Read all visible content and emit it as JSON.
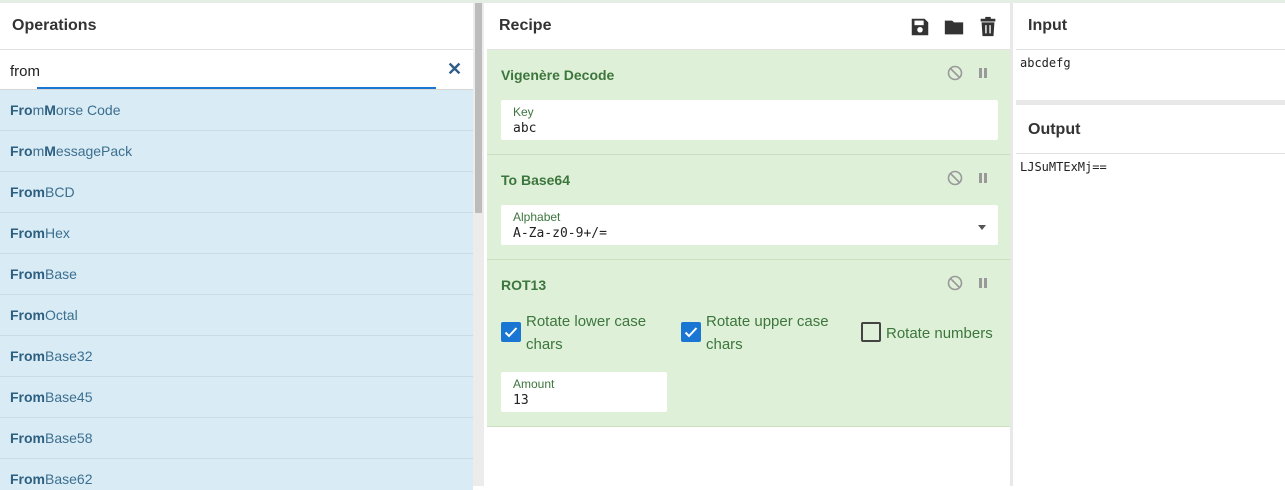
{
  "operations": {
    "title": "Operations",
    "search": {
      "value": "from",
      "clear_icon": "close-icon"
    },
    "items": [
      {
        "bold": "Fro",
        "mid": "m ",
        "bold2": "M",
        "rest": "orse Code"
      },
      {
        "bold": "Fro",
        "mid": "m ",
        "bold2": "M",
        "rest": "essagePack"
      },
      {
        "bold": "From",
        "mid": " BCD",
        "bold2": "",
        "rest": ""
      },
      {
        "bold": "From",
        "mid": " Hex",
        "bold2": "",
        "rest": ""
      },
      {
        "bold": "From",
        "mid": " Base",
        "bold2": "",
        "rest": ""
      },
      {
        "bold": "From",
        "mid": " Octal",
        "bold2": "",
        "rest": ""
      },
      {
        "bold": "From",
        "mid": " Base32",
        "bold2": "",
        "rest": ""
      },
      {
        "bold": "From",
        "mid": " Base45",
        "bold2": "",
        "rest": ""
      },
      {
        "bold": "From",
        "mid": " Base58",
        "bold2": "",
        "rest": ""
      },
      {
        "bold": "From",
        "mid": " Base62",
        "bold2": "",
        "rest": ""
      }
    ]
  },
  "recipe": {
    "title": "Recipe",
    "icons": [
      "save-icon",
      "folder-icon",
      "trash-icon"
    ],
    "steps": [
      {
        "name": "Vigenère Decode",
        "field_label": "Key",
        "field_value": "abc"
      },
      {
        "name": "To Base64",
        "field_label": "Alphabet",
        "field_value": "A-Za-z0-9+/="
      },
      {
        "name": "ROT13",
        "checks": [
          {
            "label_1": "Rotate lower case",
            "label_2": "chars",
            "checked": true
          },
          {
            "label_1": "Rotate upper case",
            "label_2": "chars",
            "checked": true
          },
          {
            "label_1": "Rotate numbers",
            "label_2": "",
            "checked": false
          }
        ],
        "field_label": "Amount",
        "field_value": "13"
      }
    ]
  },
  "input": {
    "title": "Input",
    "value": "abcdefg"
  },
  "output": {
    "title": "Output",
    "value": "LJSuMTExMj=="
  },
  "colors": {
    "accent": "#1976d2",
    "recipe_bg": "#dff0d8",
    "list_bg": "#d9ebf5",
    "recipe_text": "#3c763d"
  }
}
